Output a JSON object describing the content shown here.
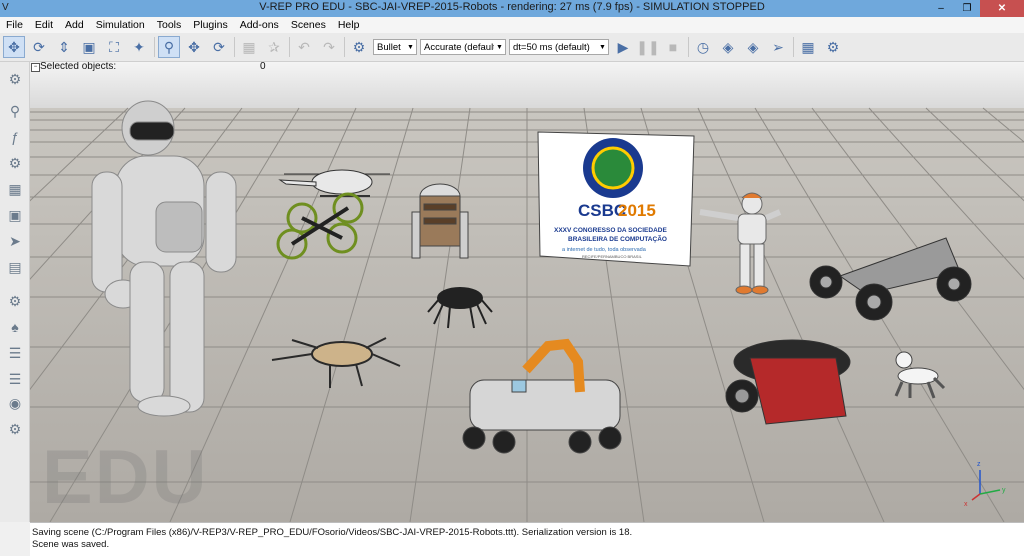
{
  "window": {
    "title": "V-REP PRO EDU - SBC-JAI-VREP-2015-Robots - rendering: 27 ms (7.9 fps) - SIMULATION STOPPED",
    "app_icon": "V",
    "minimize_glyph": "–",
    "maximize_glyph": "❐",
    "close_glyph": "✕"
  },
  "menu": [
    "File",
    "Edit",
    "Add",
    "Simulation",
    "Tools",
    "Plugins",
    "Add-ons",
    "Scenes",
    "Help"
  ],
  "toolbar": {
    "physics_engine": "Bullet",
    "accuracy": "Accurate (default)",
    "timestep": "dt=50 ms (default)"
  },
  "viewport": {
    "selected_label": "Selected objects:",
    "selected_count": "0",
    "watermark": "EDU",
    "banner": {
      "brand_csbc": "CSBC",
      "brand_year": "2015",
      "line1": "XXXV CONGRESSO DA SOCIEDADE",
      "line2": "BRASILEIRA DE COMPUTAÇÃO",
      "tagline": "a internet de tudo, toda observada",
      "location": "RECIFE/PERNAMBUCO BRASIL"
    },
    "axes": {
      "x": "x",
      "y": "y",
      "z": "z"
    }
  },
  "status": {
    "line1": "Saving scene (C:/Program Files (x86)/V-REP3/V-REP_PRO_EDU/FOsorio/Videos/SBC-JAI-VREP-2015-Robots.ttt). Serialization version is 18.",
    "line2": "Scene was saved."
  },
  "icons": {
    "toolbar": [
      "camera-pan-icon",
      "camera-rotate-icon",
      "camera-shift-icon",
      "camera-angle-icon",
      "fit-to-view-icon",
      "fly-icon",
      "object-select-icon",
      "object-shift-icon",
      "object-rotate-icon",
      "assemble-icon",
      "transfer-dna-icon",
      "undo-icon",
      "redo-icon",
      "dynamics-icon",
      "play-icon",
      "pause-icon",
      "stop-icon",
      "realtime-icon",
      "slower-icon",
      "faster-icon",
      "thread-icon",
      "page-icon",
      "scene-icon"
    ],
    "left": [
      "object-properties-icon",
      "calculation-module-icon",
      "scripts-icon",
      "shape-edit-icon",
      "selection-icon",
      "model-browser-icon",
      "scene-hierarchy-icon",
      "layers-icon",
      "video-recorder-icon",
      "user-settings-icon"
    ]
  },
  "colors": {
    "titlebar": "#6fa8dc",
    "close_button": "#c75050",
    "banner_blue": "#1a3a8f"
  }
}
